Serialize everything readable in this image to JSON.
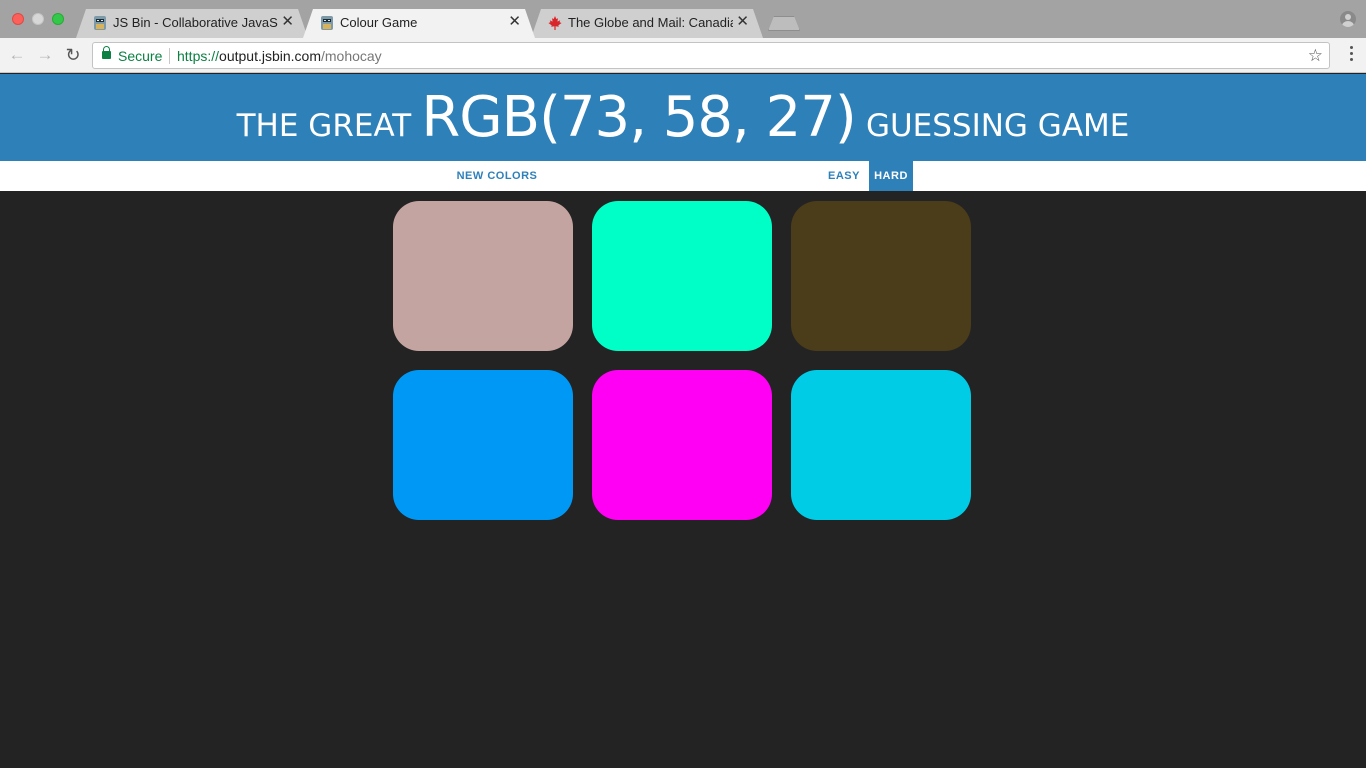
{
  "browser": {
    "tabs": [
      {
        "title": "JS Bin - Collaborative JavaScript Debugging",
        "active": false,
        "favicon": "jsbin-icon"
      },
      {
        "title": "Colour Game",
        "active": true,
        "favicon": "jsbin-icon"
      },
      {
        "title": "The Globe and Mail: Canadian, World, Politics and Business News",
        "active": false,
        "favicon": "maple-leaf-icon"
      }
    ],
    "close_glyph": "✕",
    "secure_label": "Secure",
    "url": {
      "scheme": "https://",
      "host": "output.jsbin.com",
      "path": "/mohocay"
    }
  },
  "game": {
    "title_prefix": "THE GREAT",
    "color_display": "RGB(73, 58, 27)",
    "title_suffix": "GUESSING GAME",
    "header_color": "#2e80b9",
    "background_color": "#232323",
    "controls": {
      "new_colors": "NEW COLORS",
      "easy": "EASY",
      "hard": "HARD",
      "selected_mode": "HARD"
    },
    "squares": [
      "#c4a4a0",
      "#00ffc6",
      "#4b3c1a",
      "#0098f5",
      "#ff00f5",
      "#00cce6"
    ]
  }
}
